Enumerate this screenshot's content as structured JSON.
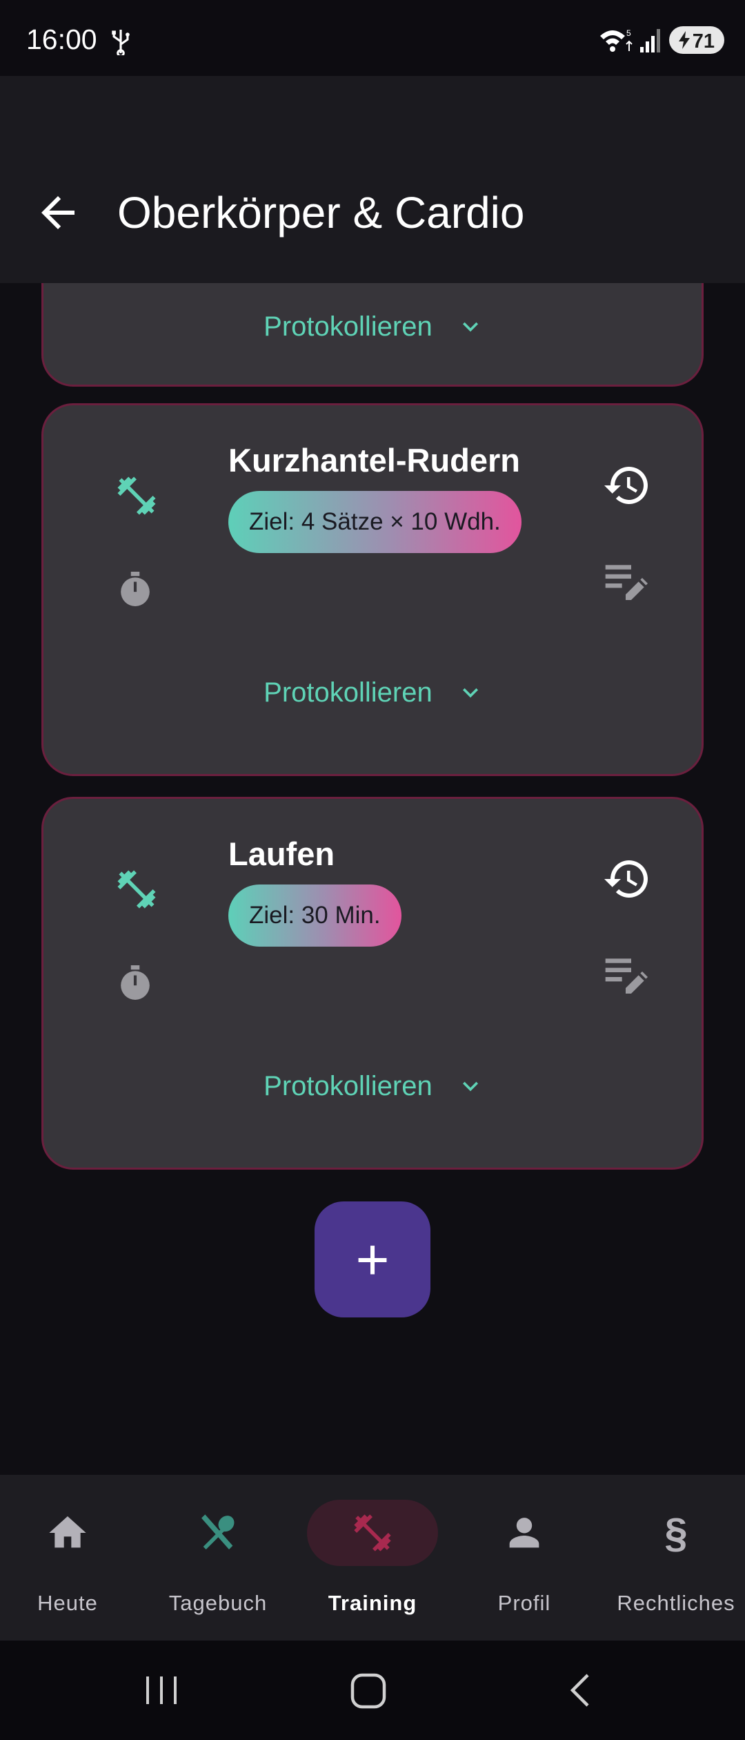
{
  "status_bar": {
    "time": "16:00",
    "battery": "71",
    "icons": [
      "usb-icon",
      "wifi-icon",
      "signal-icon",
      "battery-icon"
    ]
  },
  "app_bar": {
    "title": "Oberkörper & Cardio",
    "back_icon": "arrow-back-icon"
  },
  "cards": [
    {
      "partial": true,
      "log_label": "Protokollieren"
    },
    {
      "name": "Kurzhantel-Rudern",
      "goal": "Ziel: 4 Sätze × 10 Wdh.",
      "log_label": "Protokollieren"
    },
    {
      "name": "Laufen",
      "goal": "Ziel: 30 Min.",
      "log_label": "Protokollieren"
    }
  ],
  "fab": {
    "label": "+"
  },
  "bottom_nav": {
    "items": [
      {
        "label": "Heute",
        "icon": "home-icon"
      },
      {
        "label": "Tagebuch",
        "icon": "fork-spoon-icon"
      },
      {
        "label": "Training",
        "icon": "dumbbell-icon",
        "active": true
      },
      {
        "label": "Profil",
        "icon": "person-icon"
      },
      {
        "label": "Rechtliches",
        "icon": "section-icon"
      }
    ]
  },
  "colors": {
    "accent_teal": "#5fd3b6",
    "accent_pink": "#e2559d",
    "card_border": "#6b1f3e",
    "fab": "#4b368e",
    "active_nav": "#a8294f"
  }
}
